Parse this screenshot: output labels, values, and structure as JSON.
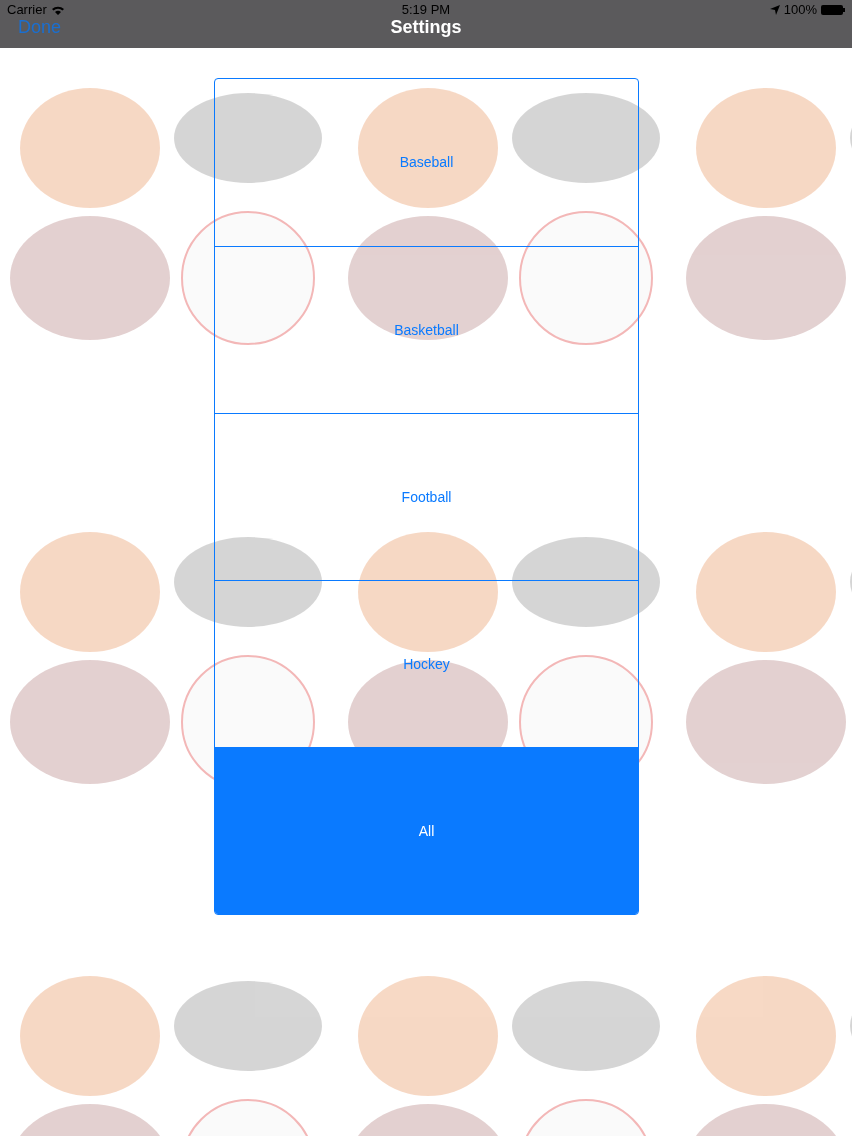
{
  "status_bar": {
    "carrier": "Carrier",
    "time": "5:19 PM",
    "battery": "100%"
  },
  "nav_bar": {
    "back": "Done",
    "title": "Settings"
  },
  "options": [
    {
      "label": "Baseball",
      "selected": false
    },
    {
      "label": "Basketball",
      "selected": false
    },
    {
      "label": "Football",
      "selected": false
    },
    {
      "label": "Hockey",
      "selected": false
    },
    {
      "label": "All",
      "selected": true
    }
  ]
}
